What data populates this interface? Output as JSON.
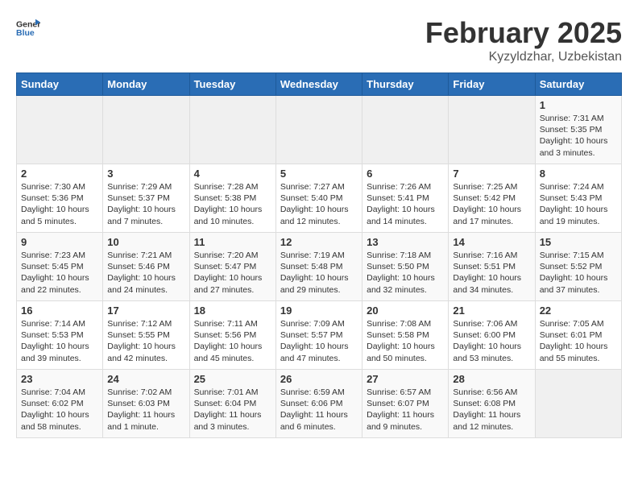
{
  "logo": {
    "line1": "General",
    "line2": "Blue"
  },
  "header": {
    "title": "February 2025",
    "subtitle": "Kyzyldzhar, Uzbekistan"
  },
  "weekdays": [
    "Sunday",
    "Monday",
    "Tuesday",
    "Wednesday",
    "Thursday",
    "Friday",
    "Saturday"
  ],
  "weeks": [
    [
      {
        "day": "",
        "info": ""
      },
      {
        "day": "",
        "info": ""
      },
      {
        "day": "",
        "info": ""
      },
      {
        "day": "",
        "info": ""
      },
      {
        "day": "",
        "info": ""
      },
      {
        "day": "",
        "info": ""
      },
      {
        "day": "1",
        "info": "Sunrise: 7:31 AM\nSunset: 5:35 PM\nDaylight: 10 hours and 3 minutes."
      }
    ],
    [
      {
        "day": "2",
        "info": "Sunrise: 7:30 AM\nSunset: 5:36 PM\nDaylight: 10 hours and 5 minutes."
      },
      {
        "day": "3",
        "info": "Sunrise: 7:29 AM\nSunset: 5:37 PM\nDaylight: 10 hours and 7 minutes."
      },
      {
        "day": "4",
        "info": "Sunrise: 7:28 AM\nSunset: 5:38 PM\nDaylight: 10 hours and 10 minutes."
      },
      {
        "day": "5",
        "info": "Sunrise: 7:27 AM\nSunset: 5:40 PM\nDaylight: 10 hours and 12 minutes."
      },
      {
        "day": "6",
        "info": "Sunrise: 7:26 AM\nSunset: 5:41 PM\nDaylight: 10 hours and 14 minutes."
      },
      {
        "day": "7",
        "info": "Sunrise: 7:25 AM\nSunset: 5:42 PM\nDaylight: 10 hours and 17 minutes."
      },
      {
        "day": "8",
        "info": "Sunrise: 7:24 AM\nSunset: 5:43 PM\nDaylight: 10 hours and 19 minutes."
      }
    ],
    [
      {
        "day": "9",
        "info": "Sunrise: 7:23 AM\nSunset: 5:45 PM\nDaylight: 10 hours and 22 minutes."
      },
      {
        "day": "10",
        "info": "Sunrise: 7:21 AM\nSunset: 5:46 PM\nDaylight: 10 hours and 24 minutes."
      },
      {
        "day": "11",
        "info": "Sunrise: 7:20 AM\nSunset: 5:47 PM\nDaylight: 10 hours and 27 minutes."
      },
      {
        "day": "12",
        "info": "Sunrise: 7:19 AM\nSunset: 5:48 PM\nDaylight: 10 hours and 29 minutes."
      },
      {
        "day": "13",
        "info": "Sunrise: 7:18 AM\nSunset: 5:50 PM\nDaylight: 10 hours and 32 minutes."
      },
      {
        "day": "14",
        "info": "Sunrise: 7:16 AM\nSunset: 5:51 PM\nDaylight: 10 hours and 34 minutes."
      },
      {
        "day": "15",
        "info": "Sunrise: 7:15 AM\nSunset: 5:52 PM\nDaylight: 10 hours and 37 minutes."
      }
    ],
    [
      {
        "day": "16",
        "info": "Sunrise: 7:14 AM\nSunset: 5:53 PM\nDaylight: 10 hours and 39 minutes."
      },
      {
        "day": "17",
        "info": "Sunrise: 7:12 AM\nSunset: 5:55 PM\nDaylight: 10 hours and 42 minutes."
      },
      {
        "day": "18",
        "info": "Sunrise: 7:11 AM\nSunset: 5:56 PM\nDaylight: 10 hours and 45 minutes."
      },
      {
        "day": "19",
        "info": "Sunrise: 7:09 AM\nSunset: 5:57 PM\nDaylight: 10 hours and 47 minutes."
      },
      {
        "day": "20",
        "info": "Sunrise: 7:08 AM\nSunset: 5:58 PM\nDaylight: 10 hours and 50 minutes."
      },
      {
        "day": "21",
        "info": "Sunrise: 7:06 AM\nSunset: 6:00 PM\nDaylight: 10 hours and 53 minutes."
      },
      {
        "day": "22",
        "info": "Sunrise: 7:05 AM\nSunset: 6:01 PM\nDaylight: 10 hours and 55 minutes."
      }
    ],
    [
      {
        "day": "23",
        "info": "Sunrise: 7:04 AM\nSunset: 6:02 PM\nDaylight: 10 hours and 58 minutes."
      },
      {
        "day": "24",
        "info": "Sunrise: 7:02 AM\nSunset: 6:03 PM\nDaylight: 11 hours and 1 minute."
      },
      {
        "day": "25",
        "info": "Sunrise: 7:01 AM\nSunset: 6:04 PM\nDaylight: 11 hours and 3 minutes."
      },
      {
        "day": "26",
        "info": "Sunrise: 6:59 AM\nSunset: 6:06 PM\nDaylight: 11 hours and 6 minutes."
      },
      {
        "day": "27",
        "info": "Sunrise: 6:57 AM\nSunset: 6:07 PM\nDaylight: 11 hours and 9 minutes."
      },
      {
        "day": "28",
        "info": "Sunrise: 6:56 AM\nSunset: 6:08 PM\nDaylight: 11 hours and 12 minutes."
      },
      {
        "day": "",
        "info": ""
      }
    ]
  ]
}
